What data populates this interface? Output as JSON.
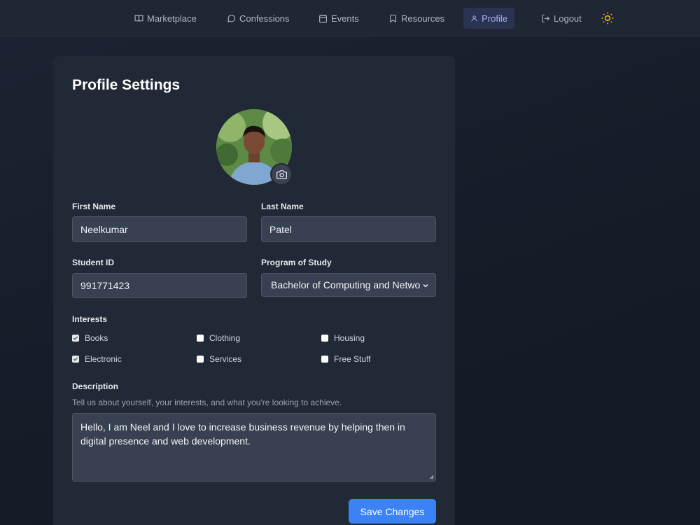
{
  "nav": {
    "items": [
      {
        "label": "Marketplace",
        "icon": "book-open-icon"
      },
      {
        "label": "Confessions",
        "icon": "message-circle-icon"
      },
      {
        "label": "Events",
        "icon": "calendar-icon"
      },
      {
        "label": "Resources",
        "icon": "bookmark-icon"
      },
      {
        "label": "Profile",
        "icon": "user-icon",
        "active": true
      },
      {
        "label": "Logout",
        "icon": "logout-icon"
      }
    ],
    "theme_icon": "sun-icon",
    "active_color": "#a5b4fc"
  },
  "profile": {
    "title": "Profile Settings",
    "avatar_icon": "profile-photo",
    "camera_icon": "camera-icon",
    "first_name": {
      "label": "First Name",
      "value": "Neelkumar"
    },
    "last_name": {
      "label": "Last Name",
      "value": "Patel"
    },
    "student_id": {
      "label": "Student ID",
      "value": "991771423"
    },
    "program": {
      "label": "Program of Study",
      "value": "Bachelor of Computing and Netwo"
    },
    "interests": {
      "label": "Interests",
      "options": [
        {
          "label": "Books",
          "checked": true
        },
        {
          "label": "Clothing",
          "checked": false
        },
        {
          "label": "Housing",
          "checked": false
        },
        {
          "label": "Electronic",
          "checked": true
        },
        {
          "label": "Services",
          "checked": false
        },
        {
          "label": "Free Stuff",
          "checked": false
        }
      ]
    },
    "description": {
      "label": "Description",
      "helper": "Tell us about yourself, your interests, and what you're looking to achieve.",
      "value": "Hello, I am Neel and I love to increase business revenue by helping then in digital presence and web development."
    },
    "save_label": "Save Changes"
  },
  "colors": {
    "accent": "#3b82f6",
    "background": "#161d2a",
    "card": "#212937",
    "input": "#374151"
  }
}
